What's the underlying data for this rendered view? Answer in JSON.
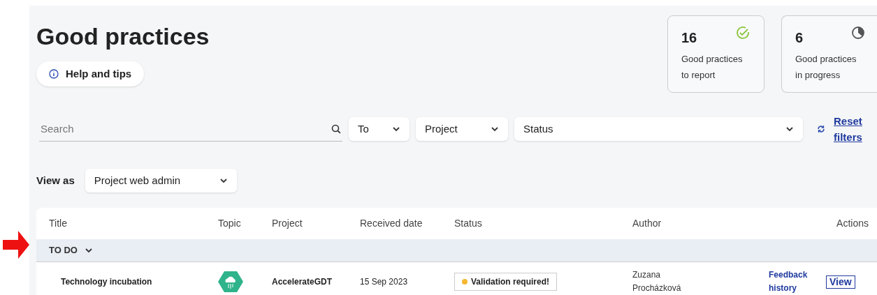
{
  "page": {
    "title": "Good practices",
    "help_button": "Help and tips"
  },
  "stats": [
    {
      "value": "16",
      "label": "Good practices to report",
      "kind": "check"
    },
    {
      "value": "6",
      "label": "Good practices in progress",
      "kind": "progress"
    }
  ],
  "search": {
    "placeholder": "Search"
  },
  "filters": [
    {
      "label": "To"
    },
    {
      "label": "Project"
    },
    {
      "label": "Status"
    }
  ],
  "reset_link": "Reset filters",
  "view_as": {
    "label": "View as",
    "value": "Project web admin"
  },
  "table": {
    "columns": [
      "Title",
      "Topic",
      "Project",
      "Received date",
      "Status",
      "Author",
      "Actions"
    ],
    "groups": [
      {
        "label": "TO DO",
        "expanded": true,
        "rows": [
          {
            "title": "Technology incubation",
            "project": "AccelerateGDT",
            "received_date": "15 Sep 2023",
            "status": {
              "label": "Validation required!",
              "color": "#f5b731"
            },
            "author": "Zuzana Procházková",
            "actions": [
              {
                "label": "Feedback history",
                "kind": "link"
              },
              {
                "label": "View",
                "kind": "button"
              }
            ]
          }
        ]
      }
    ]
  }
}
